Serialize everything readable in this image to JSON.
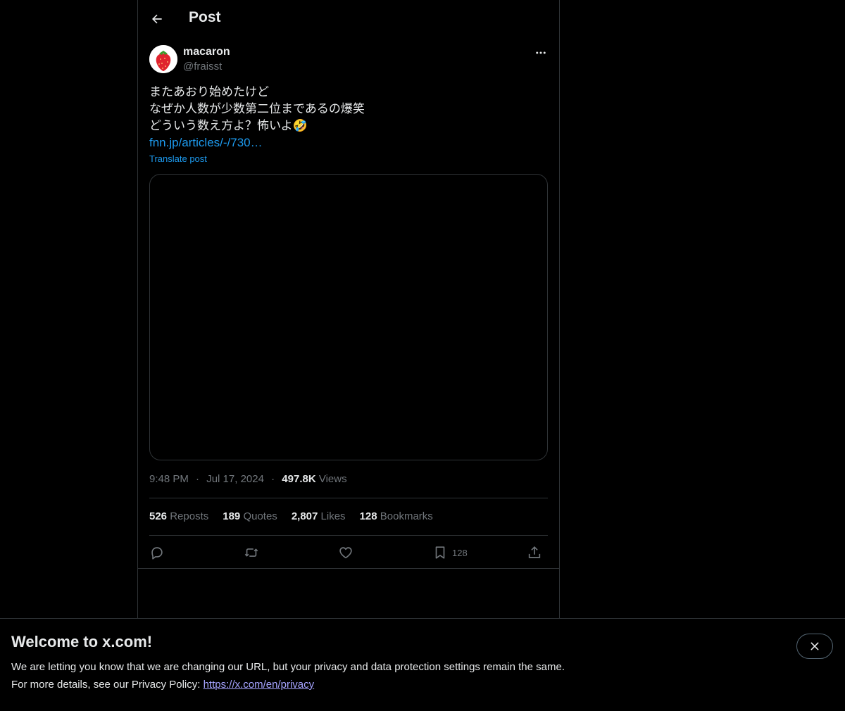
{
  "header": {
    "title": "Post"
  },
  "post": {
    "author": {
      "display_name": "macaron",
      "handle": "@fraisst"
    },
    "text_lines": [
      "またあおり始めたけど",
      "なぜか人数が少数第二位まであるの爆笑",
      "どういう数え方よ？怖いよ🤣"
    ],
    "link_text": "fnn.jp/articles/-/730…",
    "translate_label": "Translate post",
    "time": "9:48 PM",
    "date": "Jul 17, 2024",
    "views_count": "497.8K",
    "views_label": "Views",
    "separator": "·"
  },
  "stats": [
    {
      "count": "526",
      "label": "Reposts"
    },
    {
      "count": "189",
      "label": "Quotes"
    },
    {
      "count": "2,807",
      "label": "Likes"
    },
    {
      "count": "128",
      "label": "Bookmarks"
    }
  ],
  "actions": {
    "bookmark_count": "128"
  },
  "icons": {
    "back": "arrow-left-icon",
    "more": "more-horizontal-icon",
    "reply": "reply-icon",
    "repost": "repost-icon",
    "like": "heart-icon",
    "bookmark": "bookmark-icon",
    "share": "share-icon",
    "close": "close-icon"
  },
  "banner": {
    "title": "Welcome to x.com!",
    "line1": "We are letting you know that we are changing our URL, but your privacy and data protection settings remain the same.",
    "line2_prefix": "For more details, see our Privacy Policy: ",
    "privacy_link": "https://x.com/en/privacy"
  },
  "colors": {
    "background": "#000000",
    "text": "#e7e9ea",
    "muted": "#71767b",
    "link": "#1d9bf0",
    "border": "#2f3336"
  }
}
